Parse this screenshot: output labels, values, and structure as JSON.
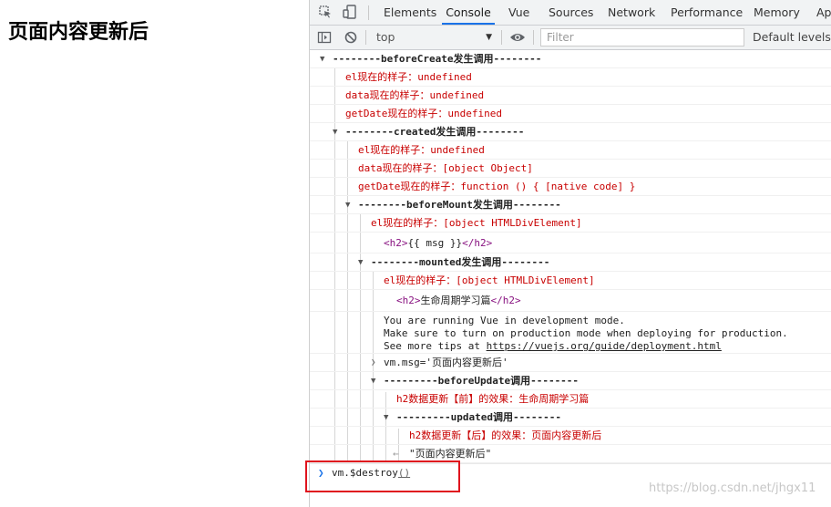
{
  "page": {
    "heading": "页面内容更新后"
  },
  "devtools": {
    "tabs": [
      "Elements",
      "Console",
      "Vue",
      "Sources",
      "Network",
      "Performance",
      "Memory",
      "Ap"
    ],
    "active_tab": "Console",
    "toolbar": {
      "context": "top",
      "filter_placeholder": "Filter",
      "levels": "Default levels"
    },
    "icons": [
      "inspect-icon",
      "device-toggle-icon",
      "sidebar-toggle-icon",
      "clear-console-icon",
      "eye-icon",
      "dropdown-arrow-icon"
    ]
  },
  "console": {
    "group_before_create": "--------beforeCreate发生调用--------",
    "bc_el": "el现在的样子：undefined",
    "bc_data": "data现在的样子：undefined",
    "bc_getdate": "getDate现在的样子：undefined",
    "group_created": "--------created发生调用--------",
    "cr_el": "el现在的样子：undefined",
    "cr_data": "data现在的样子：[object Object]",
    "cr_getdate": "getDate现在的样子：function () { [native code] }",
    "group_before_mount": "--------beforeMount发生调用--------",
    "bm_el": "el现在的样子：[object HTMLDivElement]",
    "bm_h2_open": "<h2>",
    "bm_h2_text": "{{ msg }}",
    "bm_h2_close": "</h2>",
    "group_mounted": "--------mounted发生调用--------",
    "mo_el": "el现在的样子：[object HTMLDivElement]",
    "mo_h2_open": "<h2>",
    "mo_h2_text": "生命周期学习篇",
    "mo_h2_close": "</h2>",
    "vue_dev_line1": "You are running Vue in development mode.",
    "vue_dev_line2": "Make sure to turn on production mode when deploying for production.",
    "vue_dev_line3_prefix": "See more tips at ",
    "vue_dev_link": "https://vuejs.org/guide/deployment.html",
    "input_msg": "vm.msg='页面内容更新后'",
    "group_before_update": "---------beforeUpdate调用--------",
    "bu_h2": "h2数据更新【前】的效果：生命周期学习篇",
    "group_updated": "---------updated调用--------",
    "up_h2": "h2数据更新【后】的效果：页面内容更新后",
    "result_value": "\"页面内容更新后\"",
    "prompt_input_prefix": "vm.$destroy",
    "prompt_input_parens": "()"
  },
  "watermark": "https://blog.csdn.net/jhgx11"
}
